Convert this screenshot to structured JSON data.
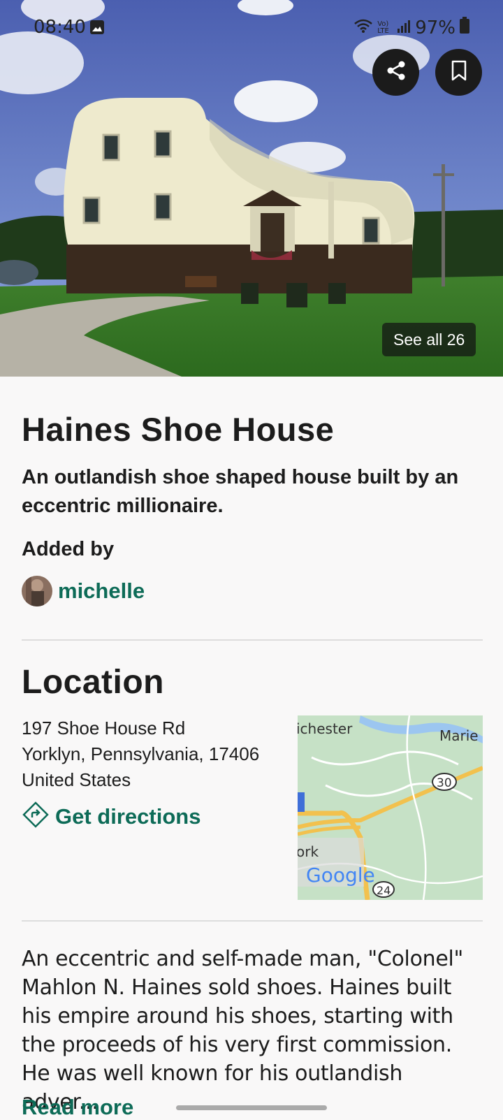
{
  "status_bar": {
    "time": "08:40",
    "battery": "97%",
    "network_label": "Vo) LTE"
  },
  "hero": {
    "see_all_label": "See all 26",
    "share_icon": "share-icon",
    "bookmark_icon": "bookmark-icon"
  },
  "place": {
    "title": "Haines Shoe House",
    "subtitle": "An outlandish shoe shaped house built by an eccentric millionaire.",
    "added_by_label": "Added by",
    "username": "michelle"
  },
  "location": {
    "heading": "Location",
    "address_line1": "197 Shoe House Rd",
    "address_line2": "Yorklyn, Pennsylvania, 17406",
    "address_line3": "United States",
    "directions_label": "Get directions",
    "map_labels": {
      "city_top": "ichester",
      "city_right": "Marie",
      "route_30": "30",
      "route_24": "24",
      "city_left": "ork",
      "provider": "Google"
    }
  },
  "description": {
    "text": "An eccentric and self-made man, \"Colonel\" Mahlon N. Haines sold shoes. Haines built his empire around his shoes, starting with the proceeds of his very first commission. He was well known for his outlandish adver...",
    "read_more_label": "Read more"
  },
  "colors": {
    "accent": "#0d6b57",
    "background": "#f9f8f8",
    "text": "#1c1c1c"
  }
}
